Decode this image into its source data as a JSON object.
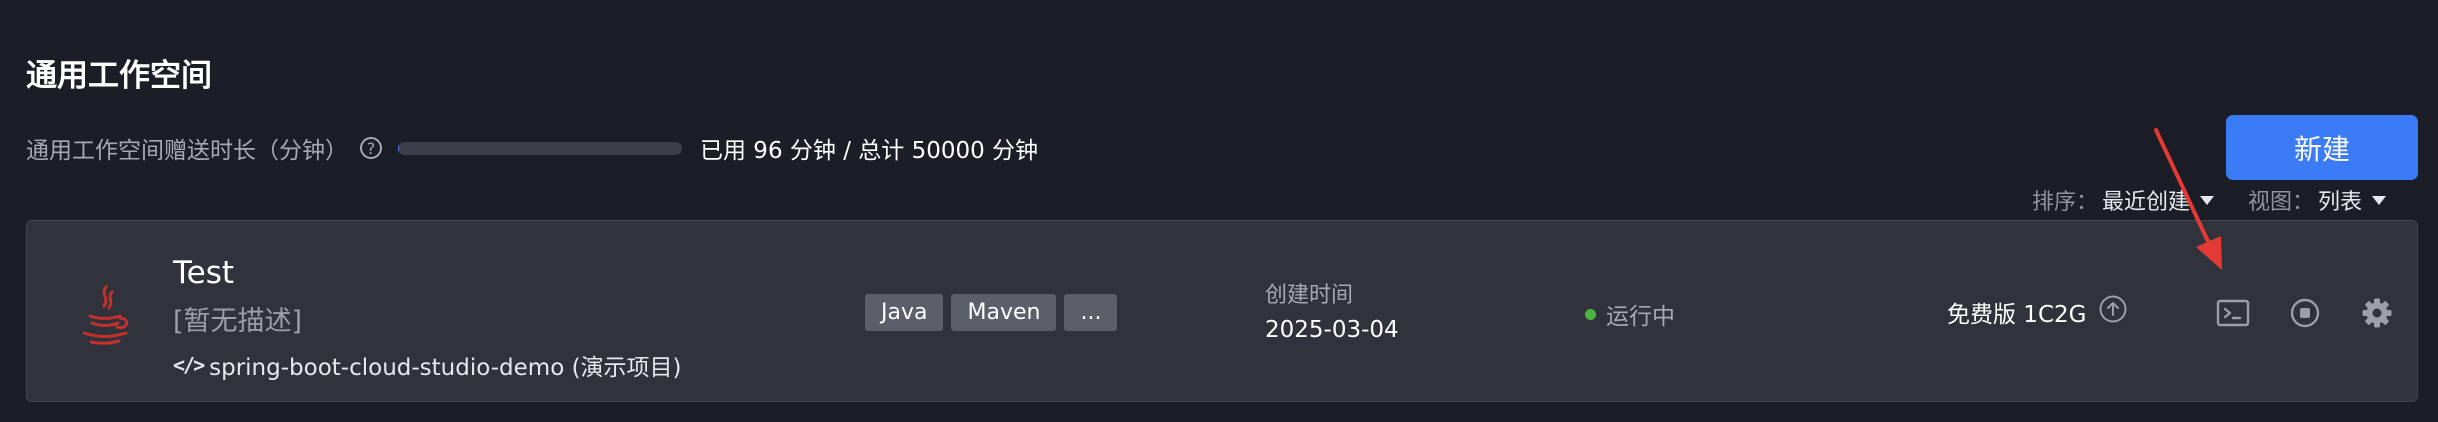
{
  "page": {
    "title": "通用工作空间"
  },
  "quota": {
    "label": "通用工作空间赠送时长（分钟）",
    "help_icon": "question-circle-icon",
    "used_fraction": 0.00192,
    "text": "已用 96 分钟 / 总计 50000 分钟"
  },
  "toolbar": {
    "new_label": "新建",
    "sort": {
      "label": "排序：",
      "value": "最近创建"
    },
    "view": {
      "label": "视图：",
      "value": "列表"
    }
  },
  "workspace": {
    "icon": "java-icon",
    "name": "Test",
    "description": "[暂无描述]",
    "repo_icon": "code-icon",
    "repo": "spring-boot-cloud-studio-demo (演示项目)",
    "tags": [
      "Java",
      "Maven",
      "..."
    ],
    "created_label": "创建时间",
    "created_value": "2025-03-04",
    "status": "运行中",
    "plan": "免费版 1C2G",
    "actions": [
      "terminal-icon",
      "stop-circle-icon",
      "gear-icon"
    ]
  },
  "colors": {
    "background": "#1b1e26",
    "card": "#30333c",
    "accent": "#3b7bf6",
    "status_running": "#4bb543",
    "annotation_arrow": "#e53935",
    "java_logo": "#c5302b"
  }
}
